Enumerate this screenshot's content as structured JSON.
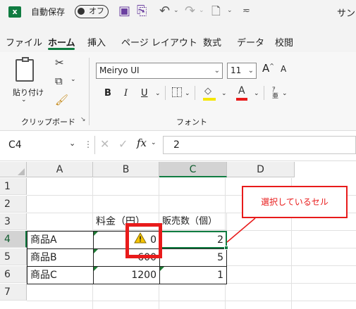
{
  "titlebar": {
    "app_icon": "excel-logo",
    "autosave_label": "自動保存",
    "autosave_state": "オフ",
    "doc_name_partial": "サン"
  },
  "ribbon_tabs": [
    "ファイル",
    "ホーム",
    "挿入",
    "ページ レイアウト",
    "数式",
    "データ",
    "校閲"
  ],
  "active_tab": "ホーム",
  "clipboard": {
    "paste_label": "貼り付け",
    "group_label": "クリップボード"
  },
  "font": {
    "name": "Meiryo UI",
    "size": "11",
    "bold": "B",
    "italic": "I",
    "underline": "U",
    "group_label": "フォント",
    "grow": "A",
    "shrink": "A"
  },
  "formula_bar": {
    "name_box": "C4",
    "fx": "fx",
    "value": "2"
  },
  "columns": [
    "A",
    "B",
    "C",
    "D"
  ],
  "rows": [
    "1",
    "2",
    "3",
    "4",
    "5",
    "6",
    "7"
  ],
  "cells": {
    "B3": "料金（円）",
    "C3": "販売数（個）",
    "A4": "商品A",
    "B4": "0",
    "C4": "2",
    "A5": "商品B",
    "B5": "600",
    "C5": "5",
    "A6": "商品C",
    "B6": "1200",
    "C6": "1"
  },
  "callout": "選択しているセル",
  "colors": {
    "excel_green": "#107c41",
    "annotation_red": "#e81b1b",
    "error_triangle": "#1e7b34",
    "warning_yellow": "#f5c400"
  }
}
